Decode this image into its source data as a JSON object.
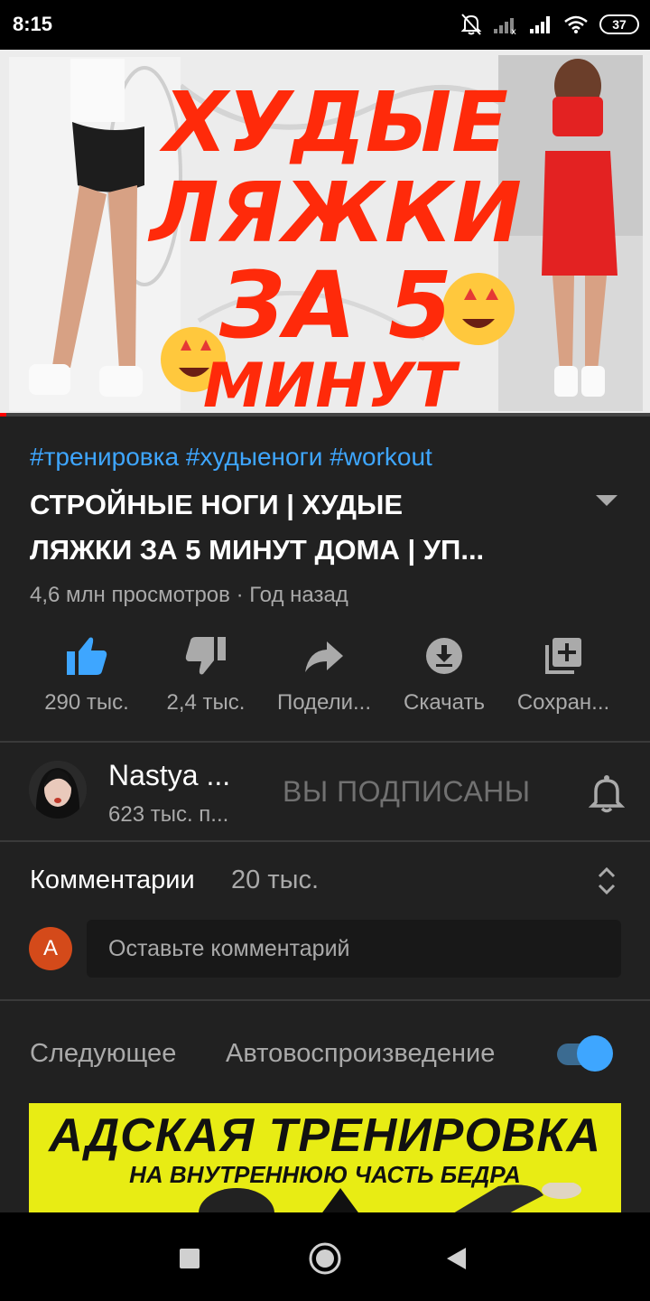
{
  "status_bar": {
    "time": "8:15",
    "battery": "37"
  },
  "video": {
    "thumbnail_text": [
      "ХУДЫЕ",
      "ЛЯЖКИ",
      "ЗА 5",
      "МИНУТ"
    ],
    "progress": 0.01
  },
  "details": {
    "hashtags": "#тренировка #худыеноги #workout",
    "title_line1": "СТРОЙНЫЕ НОГИ | ХУДЫЕ",
    "title_line2": "ЛЯЖКИ ЗА 5 МИНУТ ДОМА | УП...",
    "meta": "4,6 млн просмотров · Год назад"
  },
  "actions": [
    {
      "icon": "thumb-up-icon",
      "label": "290 тыс."
    },
    {
      "icon": "thumb-down-icon",
      "label": "2,4 тыс."
    },
    {
      "icon": "share-icon",
      "label": "Подели..."
    },
    {
      "icon": "download-icon",
      "label": "Скачать"
    },
    {
      "icon": "add-to-playlist-icon",
      "label": "Сохран..."
    }
  ],
  "channel": {
    "name": "Nastya ...",
    "subscribers": "623 тыс. п...",
    "subscribe_state": "ВЫ ПОДПИСАНЫ"
  },
  "comments": {
    "title": "Комментарии",
    "count": "20 тыс.",
    "user_initial": "A",
    "placeholder": "Оставьте комментарий"
  },
  "up_next": {
    "label": "Следующее",
    "autoplay_label": "Автовоспроизведение",
    "autoplay_on": true,
    "thumb_title": "АДСКАЯ ТРЕНИРОВКА",
    "thumb_subtitle": "НА ВНУТРЕННЮЮ ЧАСТЬ БЕДРА"
  },
  "colors": {
    "background": "#212121",
    "link_blue": "#3ea6ff",
    "progress_red": "#ff0000",
    "thumbnail_red": "#ff2a0a"
  }
}
